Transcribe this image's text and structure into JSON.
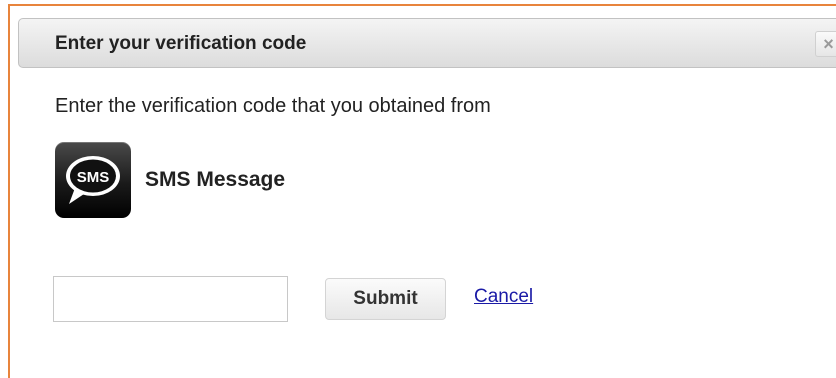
{
  "dialog": {
    "title": "Enter your verification code",
    "close_glyph": "×",
    "instructions": "Enter the verification code that you obtained from",
    "method": {
      "label": "SMS Message",
      "icon_name": "sms-icon",
      "icon_text": "SMS"
    },
    "code_input": {
      "value": "",
      "placeholder": ""
    },
    "submit_label": "Submit",
    "cancel_label": "Cancel"
  },
  "colors": {
    "frame_border": "#e8843c",
    "link": "#1a1aa6"
  }
}
